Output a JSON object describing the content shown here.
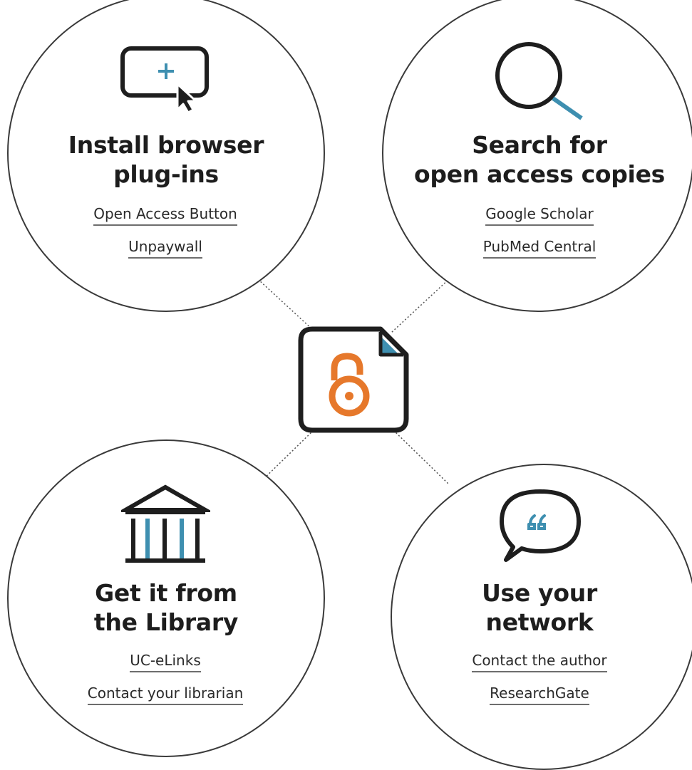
{
  "nodes": [
    {
      "id": "plugins",
      "title_line1": "Install browser",
      "title_line2": "plug-ins",
      "links": [
        "Open Access Button",
        "Unpaywall"
      ],
      "icon": "browser-cursor-plus-icon"
    },
    {
      "id": "search",
      "title_line1": "Search for",
      "title_line2": "open access copies",
      "links": [
        "Google Scholar",
        "PubMed Central"
      ],
      "icon": "magnifier-icon"
    },
    {
      "id": "library",
      "title_line1": "Get it from",
      "title_line2": "the Library",
      "links": [
        "UC-eLinks",
        "Contact your librarian"
      ],
      "icon": "library-building-icon"
    },
    {
      "id": "network",
      "title_line1": "Use your",
      "title_line2": "network",
      "links": [
        "Contact the author",
        "ResearchGate"
      ],
      "icon": "speech-bubble-quote-icon"
    }
  ],
  "center": {
    "icon": "open-access-document-icon"
  },
  "colors": {
    "outline": "#1e1e1e",
    "accent_blue": "#3e8fb0",
    "accent_orange": "#e6782b",
    "circle_border": "#3a3a3a",
    "link_underline": "#6d6d6d"
  }
}
